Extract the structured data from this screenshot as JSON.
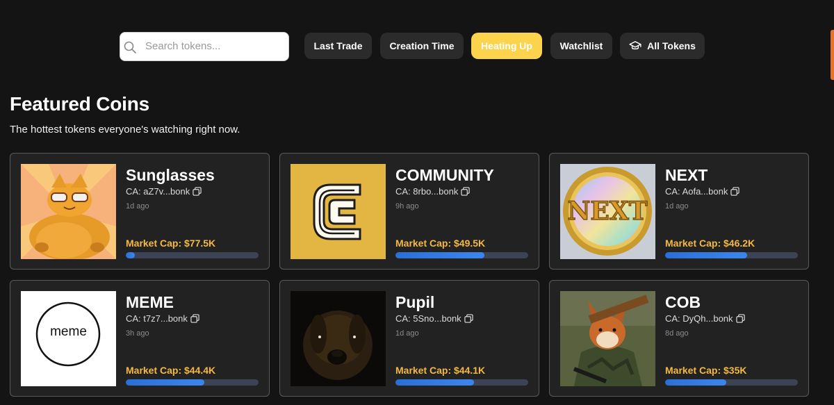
{
  "search": {
    "placeholder": "Search tokens..."
  },
  "filters": [
    {
      "label": "Last Trade",
      "active": false
    },
    {
      "label": "Creation Time",
      "active": false
    },
    {
      "label": "Heating Up",
      "active": true
    },
    {
      "label": "Watchlist",
      "active": false
    },
    {
      "label": "All Tokens",
      "active": false,
      "icon": "graduation-cap-icon"
    }
  ],
  "section": {
    "title": "Featured Coins",
    "subtitle": "The hottest tokens everyone's watching right now."
  },
  "coins": [
    {
      "name": "Sunglasses",
      "ca": "CA: aZ7v...bonk",
      "age": "1d ago",
      "market_cap": "Market Cap: $77.5K",
      "progress": 0.07
    },
    {
      "name": "COMMUNITY",
      "ca": "CA: 8rbo...bonk",
      "age": "9h ago",
      "market_cap": "Market Cap: $49.5K",
      "progress": 0.67
    },
    {
      "name": "NEXT",
      "ca": "CA: Aofa...bonk",
      "age": "1d ago",
      "market_cap": "Market Cap: $46.2K",
      "progress": 0.62
    },
    {
      "name": "MEME",
      "ca": "CA: t7z7...bonk",
      "age": "3h ago",
      "market_cap": "Market Cap: $44.4K",
      "progress": 0.59,
      "image_text": "meme"
    },
    {
      "name": "Pupil",
      "ca": "CA: 5Sno...bonk",
      "age": "1d ago",
      "market_cap": "Market Cap: $44.1K",
      "progress": 0.59
    },
    {
      "name": "COB",
      "ca": "CA: DyQh...bonk",
      "age": "8d ago",
      "market_cap": "Market Cap: $35K",
      "progress": 0.46
    }
  ],
  "colors": {
    "background": "#141414",
    "card": "#222222",
    "accent_yellow": "#fcd34d",
    "market_cap": "#f5b942",
    "progress_fill": "#3b86ee"
  }
}
